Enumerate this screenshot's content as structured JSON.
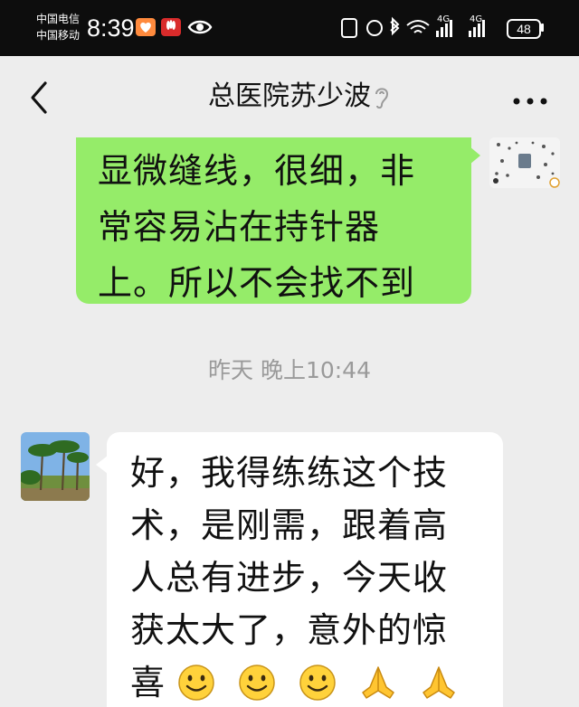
{
  "status_bar": {
    "carrier_1": "中国电信",
    "carrier_2": "中国移动",
    "time": "8:39",
    "battery": "48",
    "network_labels": [
      "4G",
      "4G"
    ],
    "icons": [
      "health-app-icon",
      "huawei-icon",
      "eye-icon",
      "nfc-icon",
      "alarm-icon",
      "bluetooth-icon",
      "wifi-icon",
      "signal-icon",
      "signal-icon",
      "battery-icon"
    ]
  },
  "header": {
    "title": "总医院苏少波",
    "back_icon": "chevron-left-icon",
    "muted_icon": "ear-icon",
    "more_icon": "more-dots-icon"
  },
  "messages": [
    {
      "direction": "outgoing",
      "lines": [
        "显微缝线，很细，非",
        "常容易沾在持针器",
        "上。所以不会找不到"
      ],
      "bubble_color": "#95ec69"
    },
    {
      "type": "timestamp",
      "text": "昨天 晚上10:44"
    },
    {
      "direction": "incoming",
      "lines": [
        "好，我得练练这个技",
        "术，是刚需，跟着高",
        "人总有进步，今天收",
        "获太大了，意外的惊",
        "喜"
      ],
      "emojis": [
        "smile-emoji",
        "smile-emoji",
        "smile-emoji",
        "pray-emoji",
        "pray-emoji"
      ],
      "bubble_color": "#ffffff"
    }
  ],
  "colors": {
    "status_bar_bg": "#0d0d0d",
    "chat_bg": "#ededed",
    "outgoing_bubble": "#95ec69",
    "incoming_bubble": "#ffffff",
    "timestamp_text": "#9a9a9a"
  }
}
